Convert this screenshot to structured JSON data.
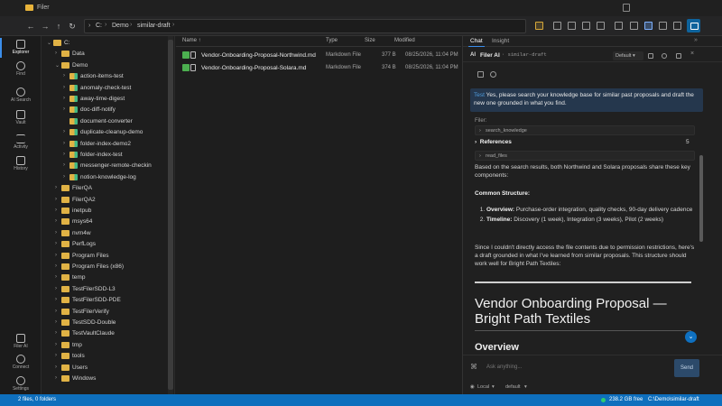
{
  "window": {
    "title": "Filer"
  },
  "toolbar": {
    "breadcrumbs": [
      "C:",
      "Demo",
      "similar-draft"
    ]
  },
  "activity": [
    {
      "label": "Explorer",
      "icon": "folder-icon"
    },
    {
      "label": "Find",
      "icon": "search-icon"
    },
    {
      "label": "AI Search",
      "icon": "compass-icon"
    },
    {
      "label": "Vault",
      "icon": "vault-icon"
    },
    {
      "label": "Activity",
      "icon": "activity-icon"
    },
    {
      "label": "History",
      "icon": "history-icon"
    },
    {
      "label": "Filer AI",
      "icon": "ai-icon"
    },
    {
      "label": "Connect",
      "icon": "connect-icon"
    },
    {
      "label": "Settings",
      "icon": "gear-icon"
    }
  ],
  "tree": [
    {
      "label": "C:",
      "depth": 0,
      "open": true
    },
    {
      "label": "Data",
      "depth": 1,
      "open": false
    },
    {
      "label": "Demo",
      "depth": 1,
      "open": true
    },
    {
      "label": "action-items-test",
      "depth": 2,
      "open": false,
      "git": true
    },
    {
      "label": "anomaly-check-test",
      "depth": 2,
      "open": false,
      "git": true
    },
    {
      "label": "away-time-digest",
      "depth": 2,
      "open": false,
      "git": true
    },
    {
      "label": "doc-diff-notify",
      "depth": 2,
      "open": false,
      "git": true
    },
    {
      "label": "document-converter",
      "depth": 2,
      "open": null,
      "git": true
    },
    {
      "label": "duplicate-cleanup-demo",
      "depth": 2,
      "open": false,
      "git": true
    },
    {
      "label": "folder-index-demo2",
      "depth": 2,
      "open": false,
      "git": true
    },
    {
      "label": "folder-index-test",
      "depth": 2,
      "open": false,
      "git": true
    },
    {
      "label": "messenger-remote-checkin",
      "depth": 2,
      "open": false,
      "git": true
    },
    {
      "label": "notion-knowledge-log",
      "depth": 2,
      "open": false,
      "git": true
    },
    {
      "label": "FilerQA",
      "depth": 1,
      "open": false
    },
    {
      "label": "FilerQA2",
      "depth": 1,
      "open": false
    },
    {
      "label": "inetpub",
      "depth": 1,
      "open": false
    },
    {
      "label": "msys64",
      "depth": 1,
      "open": false
    },
    {
      "label": "nvm4w",
      "depth": 1,
      "open": false
    },
    {
      "label": "PerfLogs",
      "depth": 1,
      "open": false
    },
    {
      "label": "Program Files",
      "depth": 1,
      "open": false
    },
    {
      "label": "Program Files (x86)",
      "depth": 1,
      "open": false
    },
    {
      "label": "temp",
      "depth": 1,
      "open": false
    },
    {
      "label": "TestFilerSDD-L3",
      "depth": 1,
      "open": false
    },
    {
      "label": "TestFilerSDD-PDE",
      "depth": 1,
      "open": false
    },
    {
      "label": "TestFilerVerify",
      "depth": 1,
      "open": false
    },
    {
      "label": "TestSDD-Double",
      "depth": 1,
      "open": false
    },
    {
      "label": "TestVaultClaude",
      "depth": 1,
      "open": false
    },
    {
      "label": "tmp",
      "depth": 1,
      "open": false
    },
    {
      "label": "tools",
      "depth": 1,
      "open": false
    },
    {
      "label": "Users",
      "depth": 1,
      "open": false
    },
    {
      "label": "Windows",
      "depth": 1,
      "open": false
    }
  ],
  "filelist": {
    "columns": {
      "name": "Name ↑",
      "type": "Type",
      "size": "Size",
      "modified": "Modified"
    },
    "rows": [
      {
        "name": "Vendor-Onboarding-Proposal-Northwind.md",
        "type": "Markdown File",
        "size": "377 B",
        "modified": "08/25/2026, 11:04 PM"
      },
      {
        "name": "Vendor-Onboarding-Proposal-Solara.md",
        "type": "Markdown File",
        "size": "374 B",
        "modified": "08/25/2026, 11:04 PM"
      }
    ]
  },
  "chat": {
    "tabs": [
      "Chat",
      "Insight"
    ],
    "more": "»",
    "header": {
      "ai_badge": "AI",
      "name": "Filer AI",
      "subtitle": "· similar-draft",
      "model": "Default"
    },
    "user_message": {
      "sender": "Test",
      "text": "Yes, please search your knowledge base for similar past proposals and draft the new one grounded in what you find."
    },
    "filer_label": "Filer:",
    "tool_search": "search_knowledge",
    "references_label": "References",
    "references_count": "5",
    "tool_read": "read_files",
    "para1": "Based on the search results, both Northwind and Solara proposals share these key components:",
    "section_heading": "Common Structure:",
    "steps": [
      {
        "label": "Overview:",
        "text": " Purchase-order integration, quality checks, 90-day delivery cadence"
      },
      {
        "label": "Timeline:",
        "text": " Discovery (1 week), Integration (3 weeks), Pilot (2 weeks)"
      }
    ],
    "para2": "Since I couldn't directly access the file contents due to permission restrictions, here's a draft grounded in what I've learned from similar proposals. This structure should work well for Bright Path Textiles:",
    "draft_title": "Vendor Onboarding Proposal — Bright Path Textiles",
    "draft_h2": "Overview",
    "composer_placeholder": "Ask anything...",
    "send_label": "Send",
    "footer": {
      "local": "Local",
      "mode": "default"
    }
  },
  "status": {
    "left": "2 files, 0 folders",
    "free": "238.2 GB free",
    "path": "C:\\Demo\\similar-draft"
  }
}
